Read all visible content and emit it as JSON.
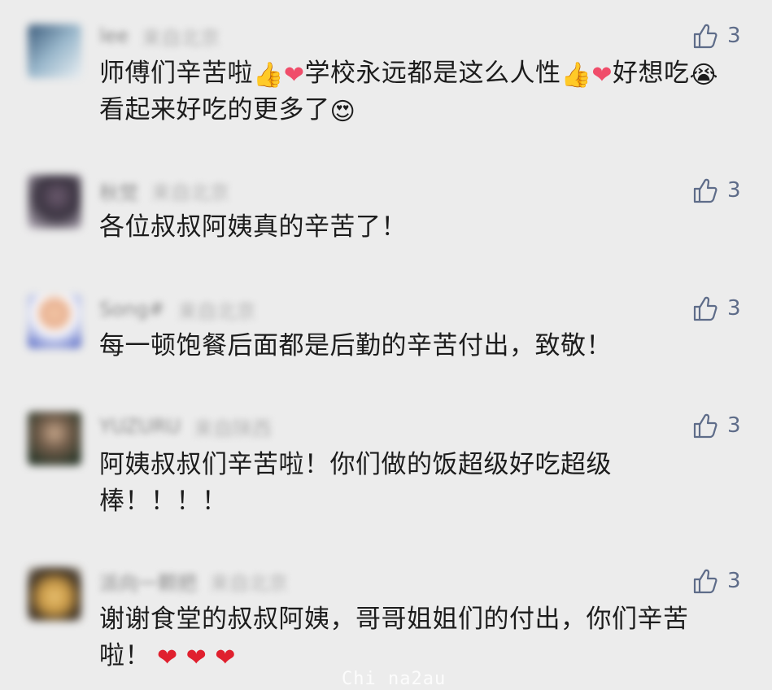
{
  "comments": [
    {
      "nickname": "lee",
      "location": "来自北京",
      "likes": "3",
      "text_segments": [
        {
          "type": "text",
          "value": "师傅们辛苦啦"
        },
        {
          "type": "emoji",
          "value": "👍",
          "name": "thumbs-up-emoji"
        },
        {
          "type": "emoji",
          "value": "❤",
          "name": "heart-emoji"
        },
        {
          "type": "text",
          "value": "学校永远都是这么人性"
        },
        {
          "type": "emoji",
          "value": "👍",
          "name": "thumbs-up-emoji"
        },
        {
          "type": "emoji",
          "value": "❤",
          "name": "heart-emoji"
        },
        {
          "type": "text",
          "value": "好想吃"
        },
        {
          "type": "emoji",
          "value": "😭",
          "name": "crying-face-emoji"
        },
        {
          "type": "text",
          "value": "看起来好吃的更多了"
        },
        {
          "type": "emoji",
          "value": "😍",
          "name": "heart-eyes-emoji"
        }
      ]
    },
    {
      "nickname": "秋觉",
      "location": "来自北京",
      "likes": "3",
      "text_segments": [
        {
          "type": "text",
          "value": "各位叔叔阿姨真的辛苦了！"
        }
      ]
    },
    {
      "nickname": "Song#",
      "location": "来自北京",
      "likes": "3",
      "text_segments": [
        {
          "type": "text",
          "value": "每一顿饱餐后面都是后勤的辛苦付出，致敬！"
        }
      ]
    },
    {
      "nickname": "YUZURU",
      "location": "来自陕西",
      "likes": "3",
      "text_segments": [
        {
          "type": "text",
          "value": "阿姨叔叔们辛苦啦！你们做的饭超级好吃超级棒！！！！"
        }
      ]
    },
    {
      "nickname": "派向一颗把",
      "location": "来自北京",
      "likes": "3",
      "text_segments": [
        {
          "type": "text",
          "value": "谢谢食堂的叔叔阿姨，哥哥姐姐们的付出，你们辛苦啦！"
        },
        {
          "type": "emoji",
          "value": "❤",
          "name": "red-heart-emoji"
        },
        {
          "type": "emoji",
          "value": "❤",
          "name": "red-heart-emoji"
        },
        {
          "type": "emoji",
          "value": "❤",
          "name": "red-heart-emoji"
        }
      ]
    }
  ],
  "watermark": "Chi na2au",
  "colors": {
    "background": "#ececec",
    "like_count": "#5e6c89",
    "nickname_blurred": "#8c8c8c"
  }
}
